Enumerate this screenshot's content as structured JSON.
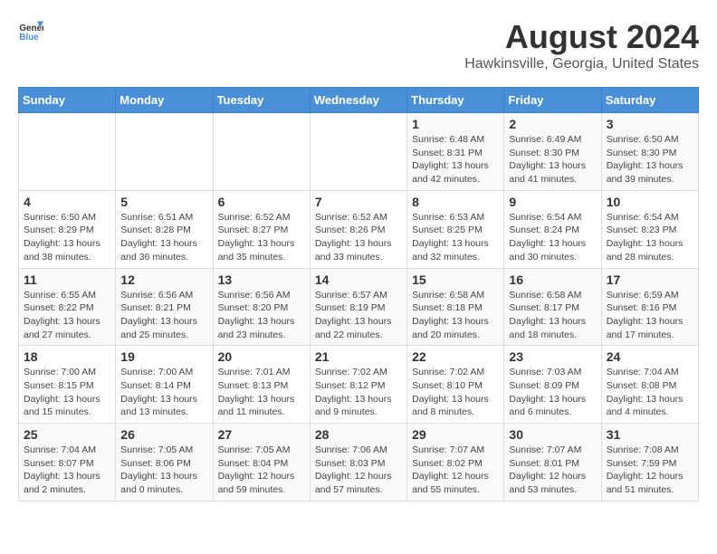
{
  "header": {
    "logo_general": "General",
    "logo_blue": "Blue",
    "title": "August 2024",
    "subtitle": "Hawkinsville, Georgia, United States"
  },
  "days_of_week": [
    "Sunday",
    "Monday",
    "Tuesday",
    "Wednesday",
    "Thursday",
    "Friday",
    "Saturday"
  ],
  "weeks": [
    [
      {
        "date": "",
        "sunrise": "",
        "sunset": "",
        "daylight": "",
        "empty": true
      },
      {
        "date": "",
        "sunrise": "",
        "sunset": "",
        "daylight": "",
        "empty": true
      },
      {
        "date": "",
        "sunrise": "",
        "sunset": "",
        "daylight": "",
        "empty": true
      },
      {
        "date": "",
        "sunrise": "",
        "sunset": "",
        "daylight": "",
        "empty": true
      },
      {
        "date": "1",
        "sunrise": "Sunrise: 6:48 AM",
        "sunset": "Sunset: 8:31 PM",
        "daylight": "Daylight: 13 hours and 42 minutes.",
        "empty": false
      },
      {
        "date": "2",
        "sunrise": "Sunrise: 6:49 AM",
        "sunset": "Sunset: 8:30 PM",
        "daylight": "Daylight: 13 hours and 41 minutes.",
        "empty": false
      },
      {
        "date": "3",
        "sunrise": "Sunrise: 6:50 AM",
        "sunset": "Sunset: 8:30 PM",
        "daylight": "Daylight: 13 hours and 39 minutes.",
        "empty": false
      }
    ],
    [
      {
        "date": "4",
        "sunrise": "Sunrise: 6:50 AM",
        "sunset": "Sunset: 8:29 PM",
        "daylight": "Daylight: 13 hours and 38 minutes.",
        "empty": false
      },
      {
        "date": "5",
        "sunrise": "Sunrise: 6:51 AM",
        "sunset": "Sunset: 8:28 PM",
        "daylight": "Daylight: 13 hours and 36 minutes.",
        "empty": false
      },
      {
        "date": "6",
        "sunrise": "Sunrise: 6:52 AM",
        "sunset": "Sunset: 8:27 PM",
        "daylight": "Daylight: 13 hours and 35 minutes.",
        "empty": false
      },
      {
        "date": "7",
        "sunrise": "Sunrise: 6:52 AM",
        "sunset": "Sunset: 8:26 PM",
        "daylight": "Daylight: 13 hours and 33 minutes.",
        "empty": false
      },
      {
        "date": "8",
        "sunrise": "Sunrise: 6:53 AM",
        "sunset": "Sunset: 8:25 PM",
        "daylight": "Daylight: 13 hours and 32 minutes.",
        "empty": false
      },
      {
        "date": "9",
        "sunrise": "Sunrise: 6:54 AM",
        "sunset": "Sunset: 8:24 PM",
        "daylight": "Daylight: 13 hours and 30 minutes.",
        "empty": false
      },
      {
        "date": "10",
        "sunrise": "Sunrise: 6:54 AM",
        "sunset": "Sunset: 8:23 PM",
        "daylight": "Daylight: 13 hours and 28 minutes.",
        "empty": false
      }
    ],
    [
      {
        "date": "11",
        "sunrise": "Sunrise: 6:55 AM",
        "sunset": "Sunset: 8:22 PM",
        "daylight": "Daylight: 13 hours and 27 minutes.",
        "empty": false
      },
      {
        "date": "12",
        "sunrise": "Sunrise: 6:56 AM",
        "sunset": "Sunset: 8:21 PM",
        "daylight": "Daylight: 13 hours and 25 minutes.",
        "empty": false
      },
      {
        "date": "13",
        "sunrise": "Sunrise: 6:56 AM",
        "sunset": "Sunset: 8:20 PM",
        "daylight": "Daylight: 13 hours and 23 minutes.",
        "empty": false
      },
      {
        "date": "14",
        "sunrise": "Sunrise: 6:57 AM",
        "sunset": "Sunset: 8:19 PM",
        "daylight": "Daylight: 13 hours and 22 minutes.",
        "empty": false
      },
      {
        "date": "15",
        "sunrise": "Sunrise: 6:58 AM",
        "sunset": "Sunset: 8:18 PM",
        "daylight": "Daylight: 13 hours and 20 minutes.",
        "empty": false
      },
      {
        "date": "16",
        "sunrise": "Sunrise: 6:58 AM",
        "sunset": "Sunset: 8:17 PM",
        "daylight": "Daylight: 13 hours and 18 minutes.",
        "empty": false
      },
      {
        "date": "17",
        "sunrise": "Sunrise: 6:59 AM",
        "sunset": "Sunset: 8:16 PM",
        "daylight": "Daylight: 13 hours and 17 minutes.",
        "empty": false
      }
    ],
    [
      {
        "date": "18",
        "sunrise": "Sunrise: 7:00 AM",
        "sunset": "Sunset: 8:15 PM",
        "daylight": "Daylight: 13 hours and 15 minutes.",
        "empty": false
      },
      {
        "date": "19",
        "sunrise": "Sunrise: 7:00 AM",
        "sunset": "Sunset: 8:14 PM",
        "daylight": "Daylight: 13 hours and 13 minutes.",
        "empty": false
      },
      {
        "date": "20",
        "sunrise": "Sunrise: 7:01 AM",
        "sunset": "Sunset: 8:13 PM",
        "daylight": "Daylight: 13 hours and 11 minutes.",
        "empty": false
      },
      {
        "date": "21",
        "sunrise": "Sunrise: 7:02 AM",
        "sunset": "Sunset: 8:12 PM",
        "daylight": "Daylight: 13 hours and 9 minutes.",
        "empty": false
      },
      {
        "date": "22",
        "sunrise": "Sunrise: 7:02 AM",
        "sunset": "Sunset: 8:10 PM",
        "daylight": "Daylight: 13 hours and 8 minutes.",
        "empty": false
      },
      {
        "date": "23",
        "sunrise": "Sunrise: 7:03 AM",
        "sunset": "Sunset: 8:09 PM",
        "daylight": "Daylight: 13 hours and 6 minutes.",
        "empty": false
      },
      {
        "date": "24",
        "sunrise": "Sunrise: 7:04 AM",
        "sunset": "Sunset: 8:08 PM",
        "daylight": "Daylight: 13 hours and 4 minutes.",
        "empty": false
      }
    ],
    [
      {
        "date": "25",
        "sunrise": "Sunrise: 7:04 AM",
        "sunset": "Sunset: 8:07 PM",
        "daylight": "Daylight: 13 hours and 2 minutes.",
        "empty": false
      },
      {
        "date": "26",
        "sunrise": "Sunrise: 7:05 AM",
        "sunset": "Sunset: 8:06 PM",
        "daylight": "Daylight: 13 hours and 0 minutes.",
        "empty": false
      },
      {
        "date": "27",
        "sunrise": "Sunrise: 7:05 AM",
        "sunset": "Sunset: 8:04 PM",
        "daylight": "Daylight: 12 hours and 59 minutes.",
        "empty": false
      },
      {
        "date": "28",
        "sunrise": "Sunrise: 7:06 AM",
        "sunset": "Sunset: 8:03 PM",
        "daylight": "Daylight: 12 hours and 57 minutes.",
        "empty": false
      },
      {
        "date": "29",
        "sunrise": "Sunrise: 7:07 AM",
        "sunset": "Sunset: 8:02 PM",
        "daylight": "Daylight: 12 hours and 55 minutes.",
        "empty": false
      },
      {
        "date": "30",
        "sunrise": "Sunrise: 7:07 AM",
        "sunset": "Sunset: 8:01 PM",
        "daylight": "Daylight: 12 hours and 53 minutes.",
        "empty": false
      },
      {
        "date": "31",
        "sunrise": "Sunrise: 7:08 AM",
        "sunset": "Sunset: 7:59 PM",
        "daylight": "Daylight: 12 hours and 51 minutes.",
        "empty": false
      }
    ]
  ]
}
